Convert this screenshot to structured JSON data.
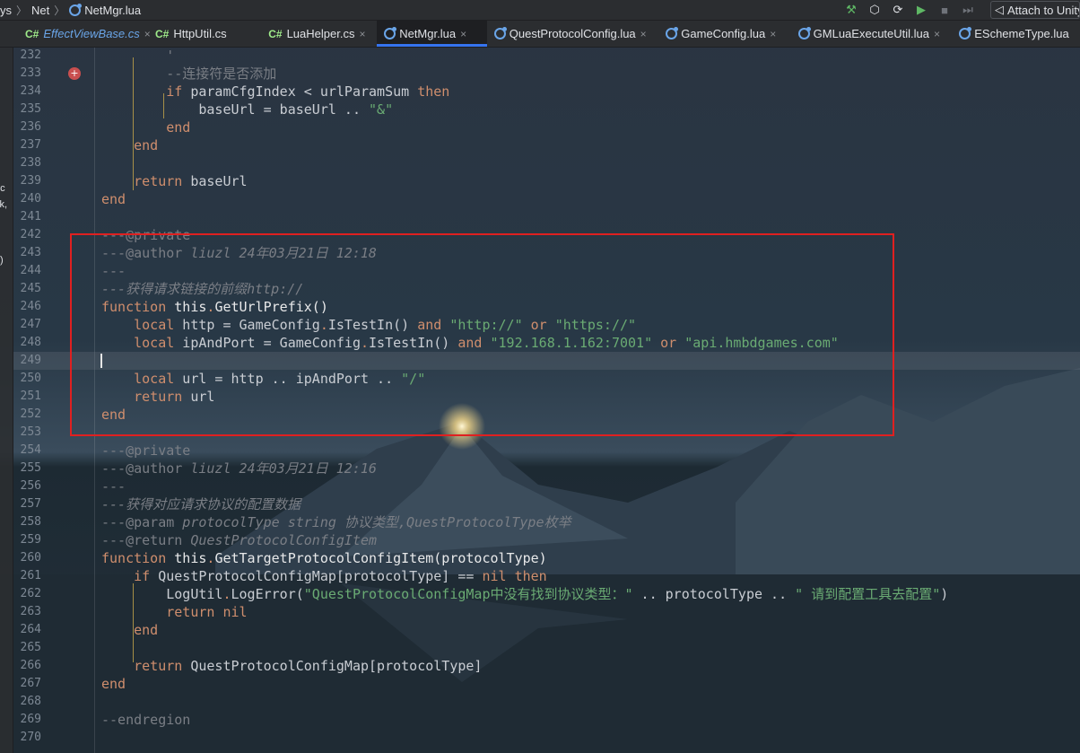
{
  "breadcrumb": {
    "items": [
      "ys",
      "Net",
      "NetMgr.lua"
    ]
  },
  "toolbar": {
    "attach_label": "Attach to Unity"
  },
  "tabs": [
    {
      "label": "EffectViewBase.cs",
      "kind": "C#",
      "active": false
    },
    {
      "label": "HttpUtil.cs",
      "kind": "C#",
      "active": false
    },
    {
      "label": "LuaHelper.cs",
      "kind": "C#",
      "active": false
    },
    {
      "label": "NetMgr.lua",
      "kind": "lua",
      "active": true
    },
    {
      "label": "QuestProtocolConfig.lua",
      "kind": "lua",
      "active": false
    },
    {
      "label": "GameConfig.lua",
      "kind": "lua",
      "active": false
    },
    {
      "label": "GMLuaExecuteUtil.lua",
      "kind": "lua",
      "active": false
    },
    {
      "label": "ESchemeType.lua",
      "kind": "lua",
      "active": false
    }
  ],
  "csharp_badge": "C#",
  "close_glyph": "×",
  "leftstrip": {
    "fragments": [
      "ys",
      ", c",
      "ck,",
      ")"
    ]
  },
  "editor": {
    "breakpoint_line": 233,
    "current_line": 249,
    "lines": [
      {
        "n": "232",
        "tokens": [
          {
            "t": "        ",
            "c": ""
          },
          {
            "t": "'",
            "c": "cm"
          }
        ]
      },
      {
        "n": "233",
        "tokens": [
          {
            "t": "        --连接符是否添加",
            "c": "cm"
          }
        ]
      },
      {
        "n": "234",
        "tokens": [
          {
            "t": "        ",
            "c": ""
          },
          {
            "t": "if",
            "c": "kw"
          },
          {
            "t": " paramCfgIndex < urlParamSum ",
            "c": ""
          },
          {
            "t": "then",
            "c": "kw"
          }
        ]
      },
      {
        "n": "235",
        "tokens": [
          {
            "t": "            baseUrl = baseUrl .. ",
            "c": ""
          },
          {
            "t": "\"&\"",
            "c": "str"
          }
        ]
      },
      {
        "n": "236",
        "tokens": [
          {
            "t": "        ",
            "c": ""
          },
          {
            "t": "end",
            "c": "kw"
          }
        ]
      },
      {
        "n": "237",
        "tokens": [
          {
            "t": "    ",
            "c": ""
          },
          {
            "t": "end",
            "c": "kw"
          }
        ]
      },
      {
        "n": "238",
        "tokens": []
      },
      {
        "n": "239",
        "tokens": [
          {
            "t": "    ",
            "c": ""
          },
          {
            "t": "return",
            "c": "kw"
          },
          {
            "t": " baseUrl",
            "c": ""
          }
        ]
      },
      {
        "n": "240",
        "tokens": [
          {
            "t": "end",
            "c": "kw"
          }
        ]
      },
      {
        "n": "241",
        "tokens": []
      },
      {
        "n": "242",
        "tokens": [
          {
            "t": "---",
            "c": "cm"
          },
          {
            "t": "@private",
            "c": "tag"
          }
        ]
      },
      {
        "n": "243",
        "tokens": [
          {
            "t": "---",
            "c": "cm"
          },
          {
            "t": "@author",
            "c": "tag"
          },
          {
            "t": " liuzl 24年03月21日 12:18",
            "c": "cmi"
          }
        ]
      },
      {
        "n": "244",
        "tokens": [
          {
            "t": "---",
            "c": "cm"
          }
        ]
      },
      {
        "n": "245",
        "tokens": [
          {
            "t": "---获得请求链接的前缀http://",
            "c": "cmi"
          }
        ]
      },
      {
        "n": "246",
        "tokens": [
          {
            "t": "function",
            "c": "kw"
          },
          {
            "t": " this",
            "c": "fn"
          },
          {
            "t": ".",
            "c": "kw"
          },
          {
            "t": "GetUrlPrefix()",
            "c": "fn"
          }
        ]
      },
      {
        "n": "247",
        "tokens": [
          {
            "t": "    ",
            "c": ""
          },
          {
            "t": "local",
            "c": "kw"
          },
          {
            "t": " http = GameConfig",
            "c": ""
          },
          {
            "t": ".",
            "c": "kw"
          },
          {
            "t": "IsTestIn() ",
            "c": ""
          },
          {
            "t": "and",
            "c": "kw"
          },
          {
            "t": " ",
            "c": ""
          },
          {
            "t": "\"http://\"",
            "c": "str"
          },
          {
            "t": " ",
            "c": ""
          },
          {
            "t": "or",
            "c": "kw"
          },
          {
            "t": " ",
            "c": ""
          },
          {
            "t": "\"https://\"",
            "c": "str"
          }
        ]
      },
      {
        "n": "248",
        "tokens": [
          {
            "t": "    ",
            "c": ""
          },
          {
            "t": "local",
            "c": "kw"
          },
          {
            "t": " ipAndPort = GameConfig",
            "c": ""
          },
          {
            "t": ".",
            "c": "kw"
          },
          {
            "t": "IsTestIn() ",
            "c": ""
          },
          {
            "t": "and",
            "c": "kw"
          },
          {
            "t": " ",
            "c": ""
          },
          {
            "t": "\"192.168.1.162:7001\"",
            "c": "str"
          },
          {
            "t": " ",
            "c": ""
          },
          {
            "t": "or",
            "c": "kw"
          },
          {
            "t": " ",
            "c": ""
          },
          {
            "t": "\"api.hmbdgames.com\"",
            "c": "str"
          }
        ]
      },
      {
        "n": "249",
        "tokens": []
      },
      {
        "n": "250",
        "tokens": [
          {
            "t": "    ",
            "c": ""
          },
          {
            "t": "local",
            "c": "kw"
          },
          {
            "t": " url = http .. ipAndPort .. ",
            "c": ""
          },
          {
            "t": "\"/\"",
            "c": "str"
          }
        ]
      },
      {
        "n": "251",
        "tokens": [
          {
            "t": "    ",
            "c": ""
          },
          {
            "t": "return",
            "c": "kw"
          },
          {
            "t": " url",
            "c": ""
          }
        ]
      },
      {
        "n": "252",
        "tokens": [
          {
            "t": "end",
            "c": "kw"
          }
        ]
      },
      {
        "n": "253",
        "tokens": []
      },
      {
        "n": "254",
        "tokens": [
          {
            "t": "---",
            "c": "cm"
          },
          {
            "t": "@private",
            "c": "tag"
          }
        ]
      },
      {
        "n": "255",
        "tokens": [
          {
            "t": "---",
            "c": "cm"
          },
          {
            "t": "@author",
            "c": "tag"
          },
          {
            "t": " liuzl 24年03月21日 12:16",
            "c": "cmi"
          }
        ]
      },
      {
        "n": "256",
        "tokens": [
          {
            "t": "---",
            "c": "cm"
          }
        ]
      },
      {
        "n": "257",
        "tokens": [
          {
            "t": "---获得对应请求协议的配置数据",
            "c": "cmi"
          }
        ]
      },
      {
        "n": "258",
        "tokens": [
          {
            "t": "---",
            "c": "cm"
          },
          {
            "t": "@param",
            "c": "tag"
          },
          {
            "t": " protocolType string 协议类型,QuestProtocolType枚举",
            "c": "cmi"
          }
        ]
      },
      {
        "n": "259",
        "tokens": [
          {
            "t": "---",
            "c": "cm"
          },
          {
            "t": "@return",
            "c": "tag"
          },
          {
            "t": " QuestProtocolConfigItem",
            "c": "cmi"
          }
        ]
      },
      {
        "n": "260",
        "tokens": [
          {
            "t": "function",
            "c": "kw"
          },
          {
            "t": " this",
            "c": "fn"
          },
          {
            "t": ".",
            "c": "kw"
          },
          {
            "t": "GetTargetProtocolConfigItem(protocolType)",
            "c": "fn"
          }
        ]
      },
      {
        "n": "261",
        "tokens": [
          {
            "t": "    ",
            "c": ""
          },
          {
            "t": "if",
            "c": "kw"
          },
          {
            "t": " QuestProtocolConfigMap[protocolType] == ",
            "c": ""
          },
          {
            "t": "nil",
            "c": "kw"
          },
          {
            "t": " ",
            "c": ""
          },
          {
            "t": "then",
            "c": "kw"
          }
        ]
      },
      {
        "n": "262",
        "tokens": [
          {
            "t": "        LogUtil",
            "c": ""
          },
          {
            "t": ".",
            "c": "kw"
          },
          {
            "t": "LogError(",
            "c": ""
          },
          {
            "t": "\"QuestProtocolConfigMap中没有找到协议类型：\"",
            "c": "str"
          },
          {
            "t": " .. protocolType .. ",
            "c": ""
          },
          {
            "t": "\" 请到配置工具去配置\"",
            "c": "str"
          },
          {
            "t": ")",
            "c": ""
          }
        ]
      },
      {
        "n": "263",
        "tokens": [
          {
            "t": "        ",
            "c": ""
          },
          {
            "t": "return",
            "c": "kw"
          },
          {
            "t": " ",
            "c": ""
          },
          {
            "t": "nil",
            "c": "kw"
          }
        ]
      },
      {
        "n": "264",
        "tokens": [
          {
            "t": "    ",
            "c": ""
          },
          {
            "t": "end",
            "c": "kw"
          }
        ]
      },
      {
        "n": "265",
        "tokens": []
      },
      {
        "n": "266",
        "tokens": [
          {
            "t": "    ",
            "c": ""
          },
          {
            "t": "return",
            "c": "kw"
          },
          {
            "t": " QuestProtocolConfigMap[protocolType]",
            "c": ""
          }
        ]
      },
      {
        "n": "267",
        "tokens": [
          {
            "t": "end",
            "c": "kw"
          }
        ]
      },
      {
        "n": "268",
        "tokens": []
      },
      {
        "n": "269",
        "tokens": [
          {
            "t": "--endregion",
            "c": "cm"
          }
        ]
      },
      {
        "n": "270",
        "tokens": []
      }
    ]
  },
  "colors": {
    "keyword": "#cf8e6d",
    "string": "#6aab73",
    "comment": "#7a7e85",
    "highlight_box": "#e02020",
    "accent": "#3574f0"
  }
}
